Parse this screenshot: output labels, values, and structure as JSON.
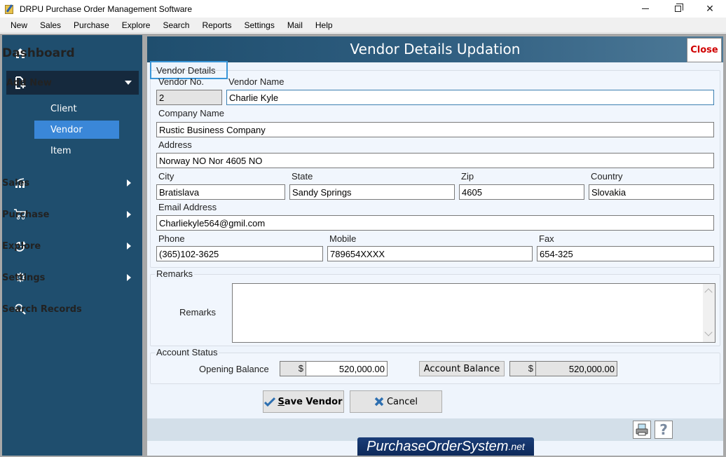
{
  "window": {
    "title": "DRPU Purchase Order Management Software",
    "icon": "app-notepad-icon"
  },
  "menu": [
    "New",
    "Sales",
    "Purchase",
    "Explore",
    "Search",
    "Reports",
    "Settings",
    "Mail",
    "Help"
  ],
  "sidebar": {
    "dashboard": "Dashboard",
    "add_new": "Add New",
    "sub_items": [
      "Client",
      "Vendor",
      "Item"
    ],
    "active_sub": "Vendor",
    "items": [
      {
        "label": "Sales",
        "icon": "chart-up-icon"
      },
      {
        "label": "Purchase",
        "icon": "cart-icon"
      },
      {
        "label": "Explore",
        "icon": "pie-chart-icon"
      },
      {
        "label": "Settings",
        "icon": "gear-icon"
      },
      {
        "label": "Search Records",
        "icon": "search-icon"
      }
    ]
  },
  "header": {
    "title": "Vendor Details Updation",
    "close_label": "Close"
  },
  "vendor_details": {
    "legend": "Vendor Details",
    "vendor_no_label": "Vendor No.",
    "vendor_no": "2",
    "vendor_name_label": "Vendor Name",
    "vendor_name": "Charlie Kyle",
    "company_label": "Company Name",
    "company": "Rustic Business Company",
    "address_label": "Address",
    "address": "Norway NO Nor 4605 NO",
    "city_label": "City",
    "city": "Bratislava",
    "state_label": "State",
    "state": "Sandy Springs",
    "zip_label": "Zip",
    "zip": "4605",
    "country_label": "Country",
    "country": "Slovakia",
    "email_label": "Email Address",
    "email": "Charliekyle564@gmil.com",
    "phone_label": "Phone",
    "phone": "(365)102-3625",
    "mobile_label": "Mobile",
    "mobile": "789654XXXX",
    "fax_label": "Fax",
    "fax": "654-325"
  },
  "remarks": {
    "legend": "Remarks",
    "label": "Remarks",
    "value": ""
  },
  "account": {
    "legend": "Account Status",
    "opening_label": "Opening Balance",
    "currency": "$",
    "opening_value": "520,000.00",
    "balance_button": "Account Balance",
    "balance_value": "520,000.00"
  },
  "actions": {
    "save": "Save Vendor",
    "cancel": "Cancel"
  },
  "footer": {
    "brand_main": "PurchaseOrderSystem",
    "brand_suffix": ".net",
    "print_icon": "printer-icon",
    "help_icon": "help-icon"
  }
}
